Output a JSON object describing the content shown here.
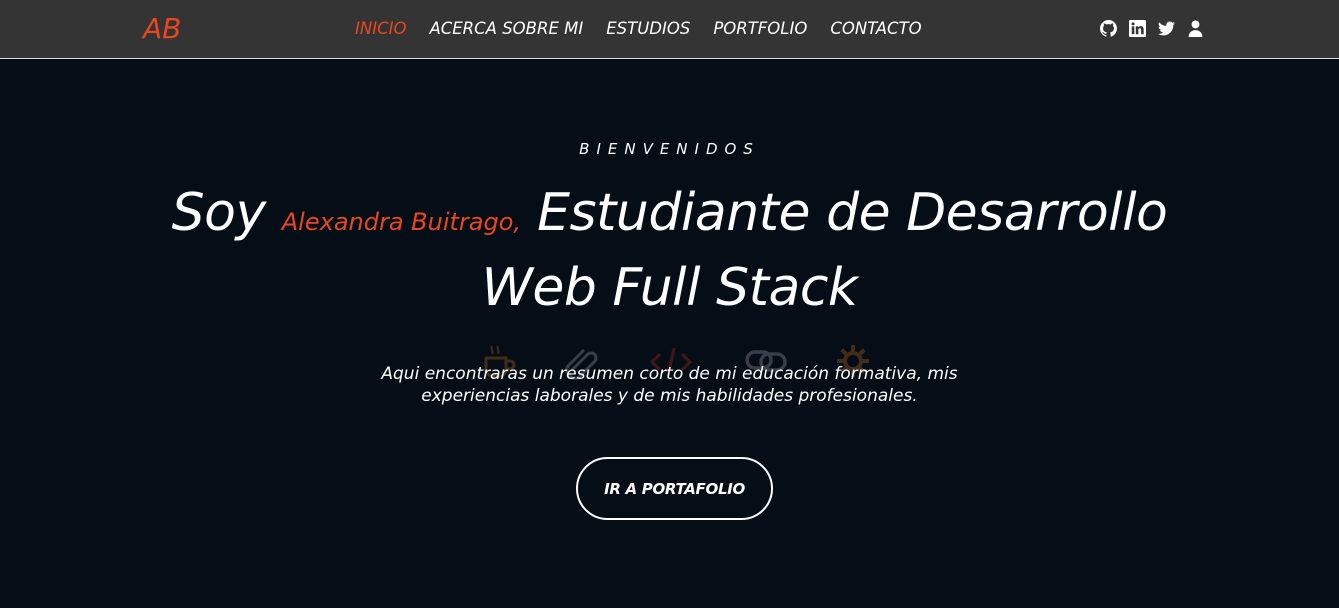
{
  "brand": {
    "logo_text": "AB",
    "accent_color": "#e8471f"
  },
  "nav": {
    "items": [
      {
        "label": "INICIO",
        "active": true
      },
      {
        "label": "ACERCA SOBRE MI",
        "active": false
      },
      {
        "label": "ESTUDIOS",
        "active": false
      },
      {
        "label": "PORTFOLIO",
        "active": false
      },
      {
        "label": "CONTACTO",
        "active": false
      }
    ]
  },
  "social": {
    "icons": [
      "github-icon",
      "linkedin-icon",
      "twitter-icon",
      "user-icon"
    ]
  },
  "hero": {
    "kicker": "BIENVENIDOS",
    "headline_prefix": "Soy",
    "name": "Alexandra Buitrago,",
    "headline_line1_rest": "Estudiante de Desarrollo",
    "headline_line2": "Web Full Stack",
    "subtitle_line1": "Aqui encontraras un resumen corto de mi educación formativa, mis",
    "subtitle_line2": "experiencias laborales y de mis habilidades profesionales.",
    "background_icons": [
      "coffee-icon",
      "paperclip-icon",
      "code-icon",
      "link-icon",
      "gear-icon"
    ],
    "cta_label": "IR A PORTAFOLIO"
  },
  "colors": {
    "navbar_bg": "#343434",
    "page_bg": "#050d17",
    "text": "#ffffff"
  }
}
